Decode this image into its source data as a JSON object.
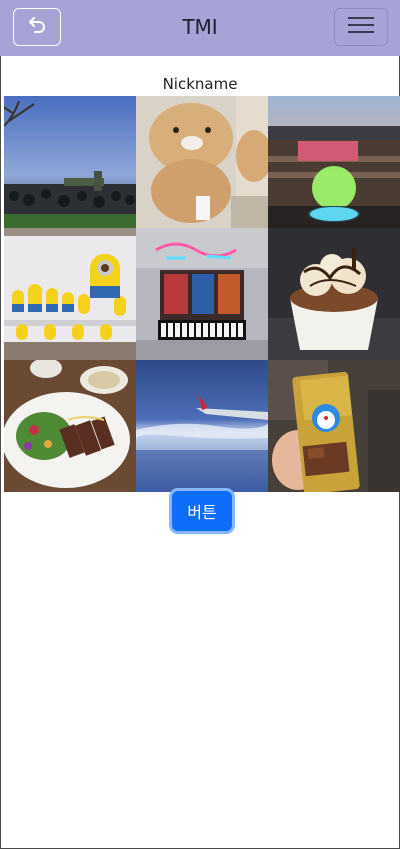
{
  "header": {
    "title": "TMI",
    "back_icon": "back-arrow-icon",
    "menu_icon": "hamburger-menu-icon"
  },
  "profile": {
    "nickname": "Nickname"
  },
  "photos": [
    {
      "subject": "evening-park-crowd"
    },
    {
      "subject": "plush-toy-figure"
    },
    {
      "subject": "stadium-lightstick"
    },
    {
      "subject": "minion-figures-shelf"
    },
    {
      "subject": "neon-sign-keyboard"
    },
    {
      "subject": "ice-cream-dessert"
    },
    {
      "subject": "steak-salad-plate"
    },
    {
      "subject": "airplane-window-sky"
    },
    {
      "subject": "doraemon-snack-pack"
    }
  ],
  "actions": {
    "button_label": "버튼"
  },
  "colors": {
    "header_bg": "#a7a3d6",
    "button_bg": "#0d6efd",
    "button_ring": "#86b7fe"
  }
}
